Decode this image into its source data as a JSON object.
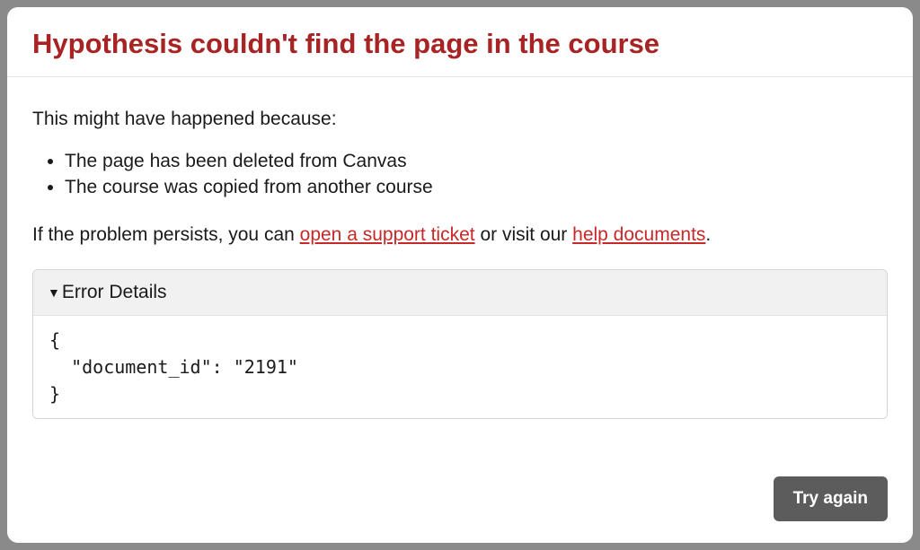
{
  "dialog": {
    "title": "Hypothesis couldn't find the page in the course",
    "intro": "This might have happened because:",
    "reasons": [
      "The page has been deleted from Canvas",
      "The course was copied from another course"
    ],
    "persist_prefix": "If the problem persists, you can ",
    "support_link": "open a support ticket",
    "persist_middle": " or visit our ",
    "help_link": "help documents",
    "persist_suffix": ".",
    "details_label": "Error Details",
    "details_code": "{\n  \"document_id\": \"2191\"\n}",
    "try_again_label": "Try again"
  }
}
